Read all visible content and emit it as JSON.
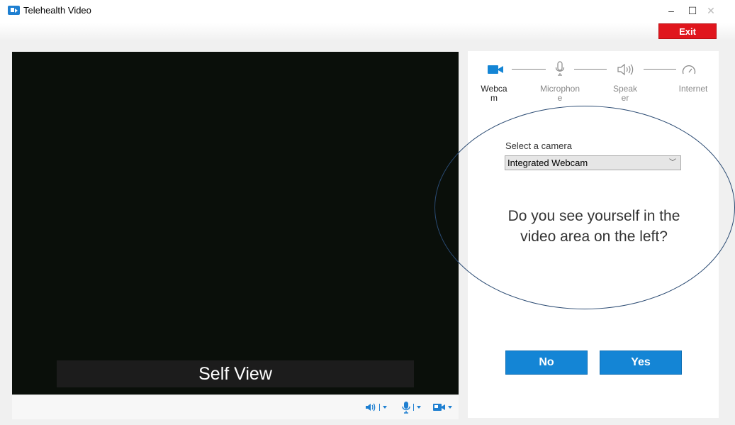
{
  "window": {
    "title": "Telehealth Video",
    "controls": {
      "minimize": "–",
      "maximize": "☐",
      "close": "✕"
    }
  },
  "header": {
    "exit_label": "Exit"
  },
  "video": {
    "self_view_label": "Self View",
    "toolbar": [
      {
        "name": "speaker-control",
        "icon": "speaker-icon"
      },
      {
        "name": "microphone-control",
        "icon": "microphone-icon"
      },
      {
        "name": "camera-control",
        "icon": "camera-icon"
      }
    ]
  },
  "setup": {
    "steps": [
      {
        "line1": "Webca",
        "line2": "m",
        "icon": "webcam-icon",
        "active": true
      },
      {
        "line1": "Microphon",
        "line2": "e",
        "icon": "microphone-icon",
        "active": false
      },
      {
        "line1": "Speak",
        "line2": "er",
        "icon": "speaker-icon",
        "active": false
      },
      {
        "line1": "Internet",
        "line2": "",
        "icon": "speedometer-icon",
        "active": false
      }
    ],
    "select_label": "Select a camera",
    "selected_camera": "Integrated Webcam",
    "question_line1": "Do you see yourself in the",
    "question_line2": "video area on the left?",
    "no_label": "No",
    "yes_label": "Yes"
  },
  "colors": {
    "accent": "#1485d5",
    "exit": "#e0161d",
    "annotation_ellipse": "#2a4a72"
  }
}
